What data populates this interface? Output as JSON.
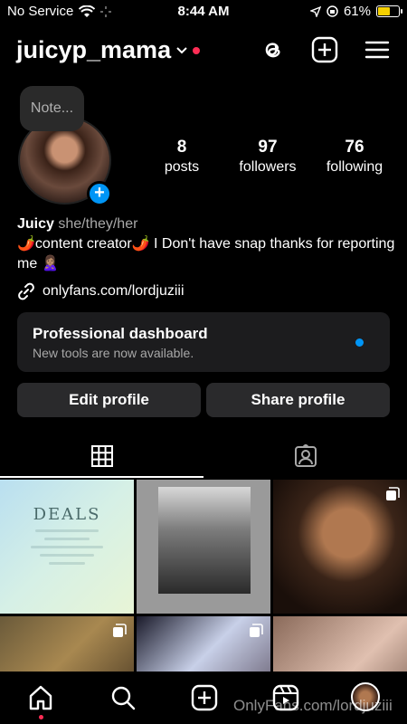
{
  "status_bar": {
    "carrier": "No Service",
    "time": "8:44 AM",
    "battery": "61%"
  },
  "header": {
    "username": "juicyp_mama"
  },
  "note": {
    "label": "Note..."
  },
  "stats": [
    {
      "value": "8",
      "label": "posts"
    },
    {
      "value": "97",
      "label": "followers"
    },
    {
      "value": "76",
      "label": "following"
    }
  ],
  "bio": {
    "name": "Juicy",
    "pronouns": "she/they/her",
    "text": "🌶️content creator🌶️ I Don't have snap thanks for reporting me 🙎🏽‍♀️",
    "link": "onlyfans.com/lordjuziii"
  },
  "dashboard": {
    "title": "Professional dashboard",
    "subtitle": "New tools are now available."
  },
  "buttons": {
    "edit": "Edit profile",
    "share": "Share profile"
  },
  "grid": {
    "deals_title": "DEALS"
  },
  "watermark": "OnlyFans.com/lordjuziii",
  "colors": {
    "accent": "#0095f6",
    "notification": "#ff2d55",
    "battery": "#f5d000"
  }
}
